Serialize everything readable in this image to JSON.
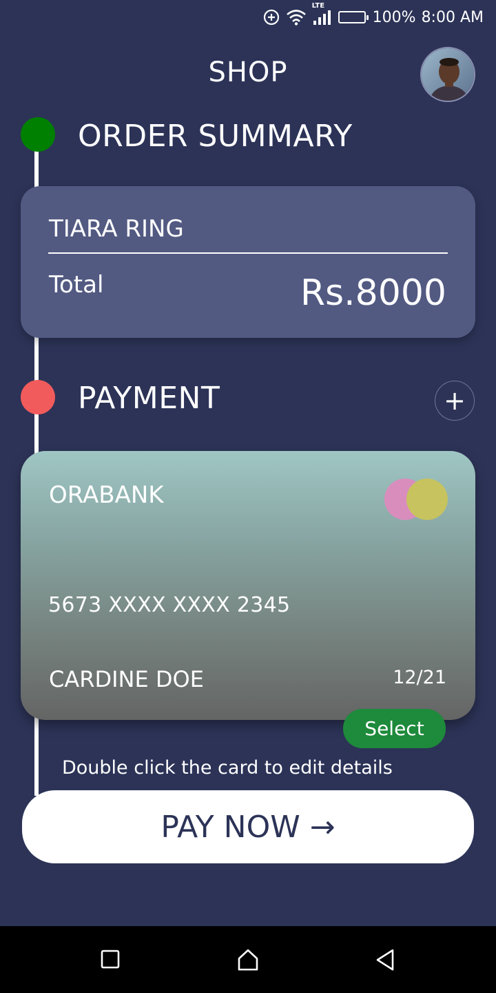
{
  "status_bar": {
    "network_type": "LTE",
    "battery": "100%",
    "time": "8:00 AM",
    "icons": [
      "data-saver-icon",
      "wifi-icon",
      "signal-icon",
      "battery-icon"
    ]
  },
  "header": {
    "title": "SHOP",
    "avatar_icon": "user-avatar"
  },
  "order_summary": {
    "title": "ORDER SUMMARY",
    "status_color": "#008000",
    "item_name": "TIARA RING",
    "total_label": "Total",
    "total_value": "Rs.8000"
  },
  "payment": {
    "title": "PAYMENT",
    "status_color": "#f25b5b",
    "add_label": "+",
    "card": {
      "bank": "ORABANK",
      "number": "5673 XXXX XXXX 2345",
      "holder": "CARDINE DOE",
      "expiry": "12/21",
      "logo_colors": [
        "#d98dbd",
        "#c7c35e"
      ]
    },
    "select_label": "Select",
    "hint": "Double click the card to edit details"
  },
  "pay_button": {
    "label": "PAY NOW",
    "arrow": "→"
  },
  "nav_bar": {
    "icons": [
      "recent-apps-icon",
      "home-icon",
      "back-icon"
    ]
  },
  "colors": {
    "background": "#2c3357",
    "summary_card": "#525a82",
    "select_button": "#1e8a3b"
  }
}
